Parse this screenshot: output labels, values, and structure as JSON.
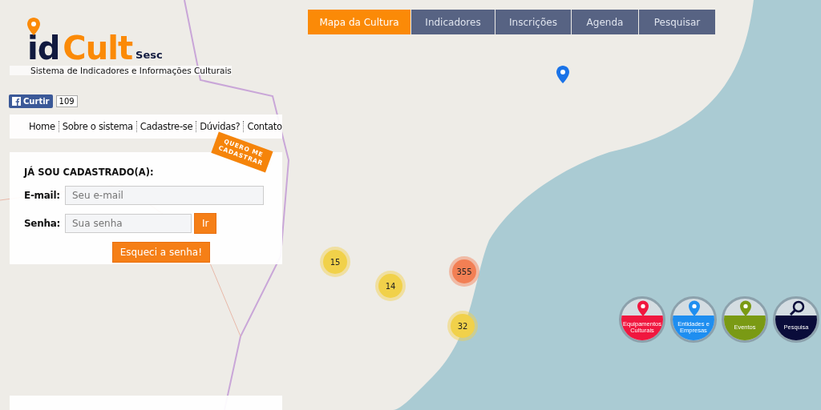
{
  "logo": {
    "brand_a": "id",
    "brand_b": "Cult",
    "sub": "Sesc",
    "tagline": "Sistema de Indicadores e Informações Culturais"
  },
  "facebook": {
    "label": "Curtir",
    "count": "109"
  },
  "site_nav": [
    "Home",
    "Sobre o sistema",
    "Cadastre-se",
    "Dúvidas?",
    "Contato"
  ],
  "signup_ribbon": "QUERO ME CADASTRAR",
  "login": {
    "title": "JÁ SOU CADASTRADO(A):",
    "email_label": "E-mail:",
    "email_placeholder": "Seu e-mail",
    "password_label": "Senha:",
    "password_placeholder": "Sua senha",
    "submit": "Ir",
    "forgot": "Esqueci a senha!"
  },
  "tabs": [
    {
      "label": "Mapa da Cultura",
      "selected": true
    },
    {
      "label": "Indicadores",
      "selected": false
    },
    {
      "label": "Inscrições",
      "selected": false
    },
    {
      "label": "Agenda",
      "selected": false
    },
    {
      "label": "Pesquisar",
      "selected": false
    }
  ],
  "clusters": [
    {
      "count": "15",
      "kind": "medium"
    },
    {
      "count": "14",
      "kind": "medium"
    },
    {
      "count": "355",
      "kind": "large"
    },
    {
      "count": "32",
      "kind": "medium"
    }
  ],
  "categories": [
    {
      "label": "Equipamentos Culturais",
      "color": "#f0173f",
      "kind": "pin"
    },
    {
      "label": "Entidades e Empresas",
      "color": "#1e8ef0",
      "kind": "pin"
    },
    {
      "label": "Eventos",
      "color": "#7a9a14",
      "kind": "pin"
    },
    {
      "label": "Pesquisa",
      "color": "#0a0c3a",
      "kind": "search"
    }
  ]
}
